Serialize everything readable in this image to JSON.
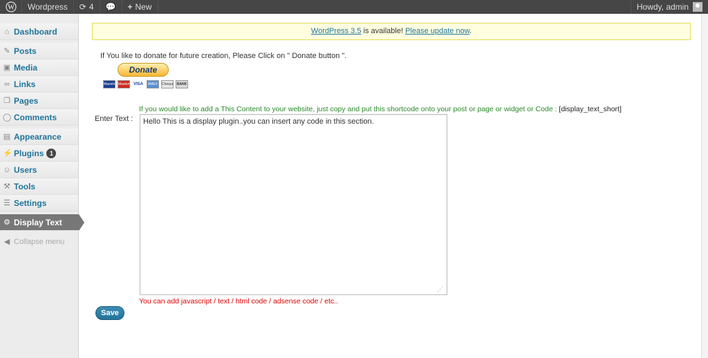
{
  "adminbar": {
    "site_name": "Wordpress",
    "updates_count": "4",
    "new_label": "New",
    "howdy": "Howdy, admin"
  },
  "sidebar": {
    "items": [
      {
        "label": "Dashboard",
        "icon": "dashboard-icon"
      },
      {
        "label": "Posts",
        "icon": "posts-icon"
      },
      {
        "label": "Media",
        "icon": "media-icon"
      },
      {
        "label": "Links",
        "icon": "links-icon"
      },
      {
        "label": "Pages",
        "icon": "pages-icon"
      },
      {
        "label": "Comments",
        "icon": "comments-icon"
      },
      {
        "label": "Appearance",
        "icon": "appearance-icon"
      },
      {
        "label": "Plugins",
        "icon": "plugins-icon",
        "badge": "1"
      },
      {
        "label": "Users",
        "icon": "users-icon"
      },
      {
        "label": "Tools",
        "icon": "tools-icon"
      },
      {
        "label": "Settings",
        "icon": "settings-icon"
      },
      {
        "label": "Display Text",
        "icon": "gear-icon"
      }
    ],
    "collapse": "Collapse menu"
  },
  "notice": {
    "link_version": "WordPress 3.5",
    "middle": " is available! ",
    "link_update": "Please update now",
    "end": "."
  },
  "donate": {
    "text": "If You like to donate for future creation, Please Click on \" Donate button \".",
    "button": "Donate",
    "cards": [
      "Maestro",
      "MasterCard",
      "VISA",
      "AMEX",
      "Cheque",
      "BANK"
    ]
  },
  "form": {
    "hint": "If you would like to add a This Content to your website, just copy and put this shortcode onto your post or page or widget or Code : ",
    "shortcode": "[display_text_short]",
    "label": "Enter Text :",
    "value": "Hello This is a display plugin..you can insert any code in this section.",
    "note": "You can add javascript / text / html code / adsense code / etc..",
    "save": "Save"
  },
  "colors": {
    "link": "#21759b",
    "notice_bg": "#ffffe0",
    "hint_green": "#2a8a2a",
    "note_red": "#dd0000"
  }
}
